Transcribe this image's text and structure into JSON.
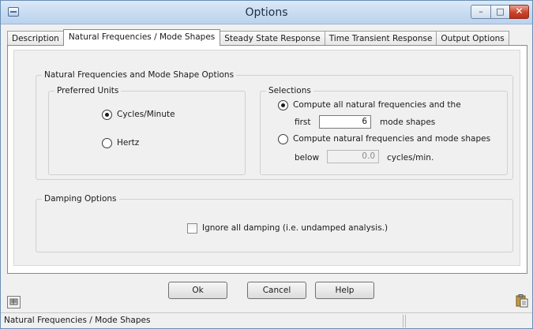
{
  "window": {
    "title": "Options",
    "controls": {
      "minimize": "–",
      "maximize": "□",
      "close": "✕"
    },
    "app_icon": "app-window-icon"
  },
  "tabs": [
    {
      "label": "Description",
      "active": false
    },
    {
      "label": "Natural Frequencies / Mode Shapes",
      "active": true
    },
    {
      "label": "Steady State Response",
      "active": false
    },
    {
      "label": "Time Transient Response",
      "active": false
    },
    {
      "label": "Output Options",
      "active": false
    }
  ],
  "mode_shape_options": {
    "legend": "Natural Frequencies and Mode Shape Options",
    "preferred_units": {
      "legend": "Preferred Units",
      "options": [
        {
          "label": "Cycles/Minute",
          "checked": true
        },
        {
          "label": "Hertz",
          "checked": false
        }
      ]
    },
    "selections": {
      "legend": "Selections",
      "compute_all": {
        "label": "Compute all natural frequencies and the",
        "checked": true
      },
      "first_label": "first",
      "first_value": "6",
      "mode_shapes_label": "mode shapes",
      "compute_below": {
        "label": "Compute natural frequencies and mode shapes",
        "checked": false
      },
      "below_label": "below",
      "below_value": "0.0",
      "below_unit": "cycles/min."
    }
  },
  "damping_options": {
    "legend": "Damping Options",
    "ignore_damping": {
      "label": "Ignore all damping (i.e. undamped analysis.)",
      "checked": false
    }
  },
  "buttons": {
    "ok": "Ok",
    "cancel": "Cancel",
    "help": "Help"
  },
  "icons": {
    "left": "keypad-icon",
    "right": "clipboard-icon"
  },
  "status_bar": {
    "text": "Natural Frequencies / Mode Shapes"
  }
}
